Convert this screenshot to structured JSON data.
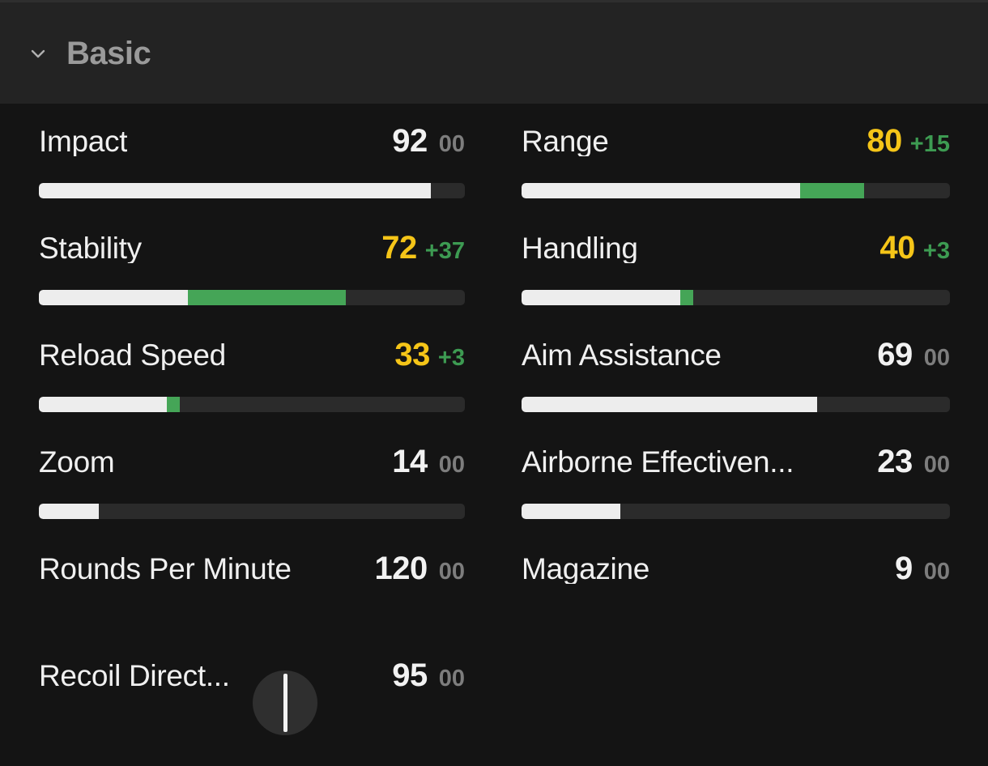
{
  "section": {
    "title": "Basic",
    "collapse_icon": "chevron-down-icon",
    "expanded": true
  },
  "colors": {
    "background": "#141414",
    "header_background": "#232323",
    "bar_track": "#2b2b2b",
    "bar_base": "#ededed",
    "bar_boost": "#45a557",
    "value_default": "#f2f2f2",
    "value_boosted": "#f5c518",
    "delta_positive": "#3d9b52",
    "delta_neutral": "#7d7d7d",
    "title": "#9a9a9a"
  },
  "stats": {
    "left_column": [
      {
        "name": "Impact",
        "value": "92",
        "delta": "00",
        "delta_positive": false,
        "boosted": false,
        "base_pct": 92,
        "total_pct": 92,
        "has_bar": true
      },
      {
        "name": "Stability",
        "value": "72",
        "delta": "+37",
        "delta_positive": true,
        "boosted": true,
        "base_pct": 35,
        "total_pct": 72,
        "has_bar": true
      },
      {
        "name": "Reload Speed",
        "value": "33",
        "delta": "+3",
        "delta_positive": true,
        "boosted": true,
        "base_pct": 30,
        "total_pct": 33,
        "has_bar": true
      },
      {
        "name": "Zoom",
        "value": "14",
        "delta": "00",
        "delta_positive": false,
        "boosted": false,
        "base_pct": 14,
        "total_pct": 14,
        "has_bar": true
      },
      {
        "name": "Rounds Per Minute",
        "value": "120",
        "delta": "00",
        "delta_positive": false,
        "boosted": false,
        "base_pct": 0,
        "total_pct": 0,
        "has_bar": false
      },
      {
        "name": "Recoil Direct...",
        "value": "95",
        "delta": "00",
        "delta_positive": false,
        "boosted": false,
        "base_pct": 0,
        "total_pct": 0,
        "has_bar": false,
        "gauge": {
          "icon": "recoil-direction-gauge-icon",
          "needle_angle_deg": 0
        }
      }
    ],
    "right_column": [
      {
        "name": "Range",
        "value": "80",
        "delta": "+15",
        "delta_positive": true,
        "boosted": true,
        "base_pct": 65,
        "total_pct": 80,
        "has_bar": true
      },
      {
        "name": "Handling",
        "value": "40",
        "delta": "+3",
        "delta_positive": true,
        "boosted": true,
        "base_pct": 37,
        "total_pct": 40,
        "has_bar": true
      },
      {
        "name": "Aim Assistance",
        "value": "69",
        "delta": "00",
        "delta_positive": false,
        "boosted": false,
        "base_pct": 69,
        "total_pct": 69,
        "has_bar": true
      },
      {
        "name": "Airborne Effectiven...",
        "value": "23",
        "delta": "00",
        "delta_positive": false,
        "boosted": false,
        "base_pct": 23,
        "total_pct": 23,
        "has_bar": true
      },
      {
        "name": "Magazine",
        "value": "9",
        "delta": "00",
        "delta_positive": false,
        "boosted": false,
        "base_pct": 0,
        "total_pct": 0,
        "has_bar": false
      }
    ]
  }
}
